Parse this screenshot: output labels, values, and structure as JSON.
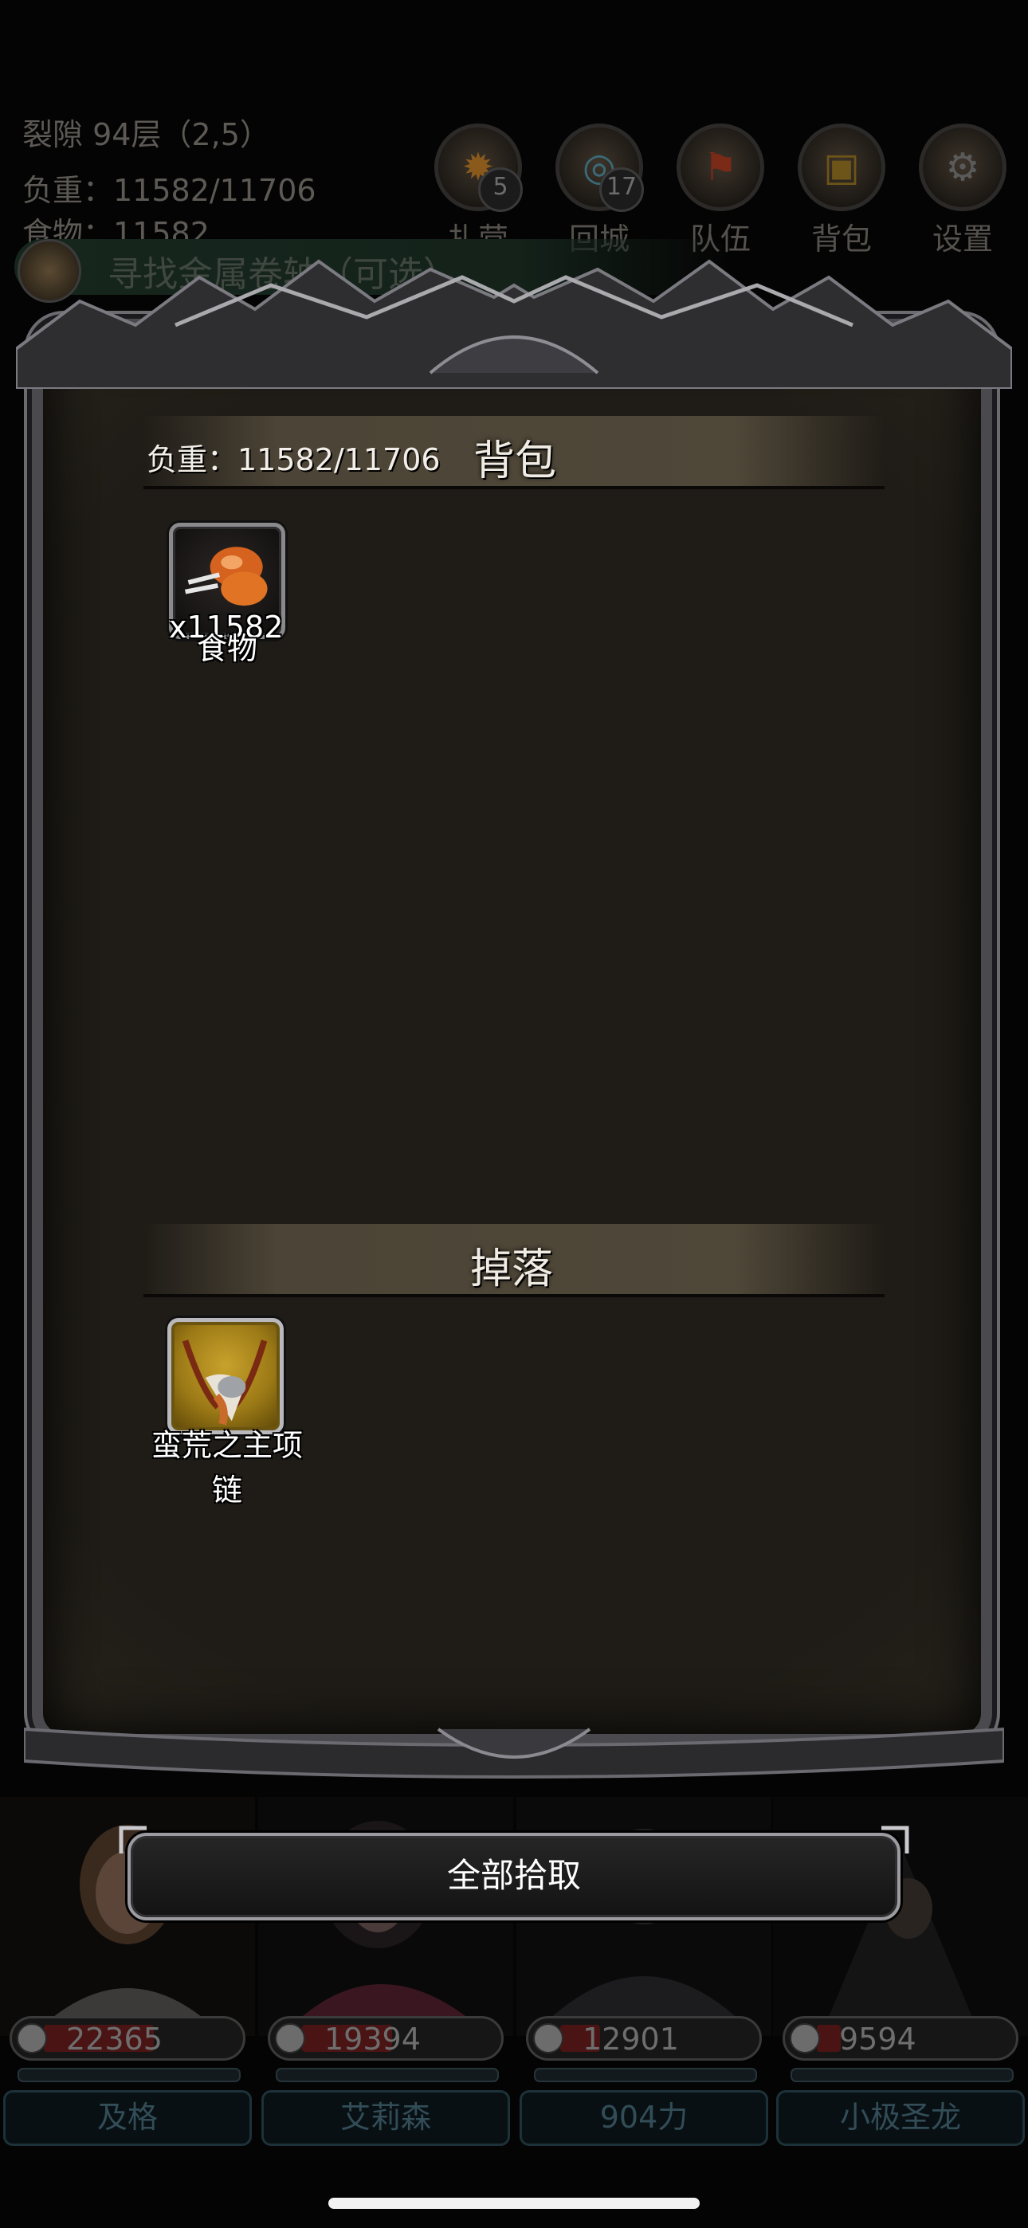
{
  "hud": {
    "location": "裂隙 94层（2,5）",
    "weight": "负重：11582/11706",
    "food": "食物：11582",
    "buttons": [
      {
        "label": "扎营",
        "count": "5",
        "icon": "campfire-icon"
      },
      {
        "label": "回城",
        "count": "17",
        "icon": "portal-icon"
      },
      {
        "label": "队伍",
        "count": "",
        "icon": "team-icon"
      },
      {
        "label": "背包",
        "count": "",
        "icon": "backpack-icon"
      },
      {
        "label": "设置",
        "count": "",
        "icon": "gear-icon"
      }
    ],
    "quest": "寻找金属卷轴（可选）"
  },
  "backpack": {
    "title": "背包",
    "weight": "负重：11582/11706",
    "items": [
      {
        "name": "食物",
        "count": "x11582",
        "icon": "roast-meat-icon",
        "rarity": "normal"
      }
    ]
  },
  "drops": {
    "title": "掉落",
    "items": [
      {
        "name_line1": "蛮荒之主项",
        "name_line2": "链",
        "icon": "fang-necklace-icon",
        "rarity": "gold"
      }
    ]
  },
  "pick_all_label": "全部拾取",
  "heroes": [
    {
      "hp": "22365",
      "hp_ratio": 0.55,
      "name": "及格"
    },
    {
      "hp": "19394",
      "hp_ratio": 0.45,
      "name": "艾莉森"
    },
    {
      "hp": "12901",
      "hp_ratio": 0.2,
      "name": "904力"
    },
    {
      "hp": "9594",
      "hp_ratio": 0.12,
      "name": "小极圣龙"
    }
  ],
  "colors": {
    "panel_border": "#4a4a4e",
    "gold_slot": "#c9a22c",
    "hp_fill": "#4a1414"
  }
}
